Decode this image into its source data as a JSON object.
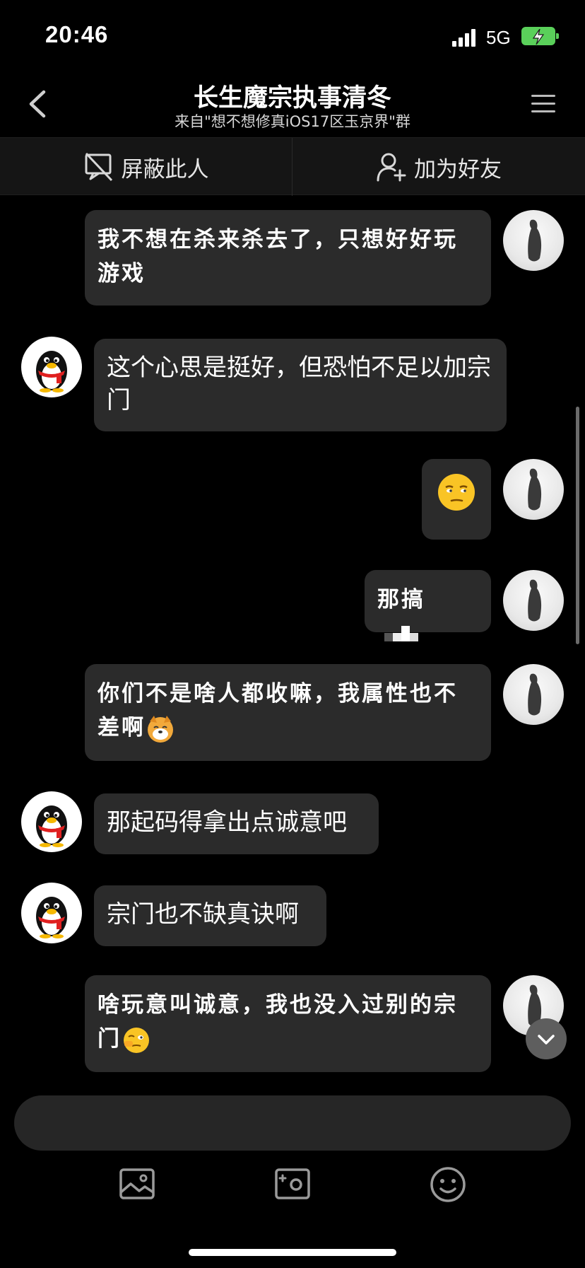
{
  "status_bar": {
    "time": "20:46",
    "network": "5G",
    "battery_color": "#5ad05a"
  },
  "header": {
    "title": "长生魔宗执事清冬",
    "subtitle": "来自\"想不想修真iOS17区玉京界\"群",
    "back_icon": "chevron-left-icon",
    "menu_icon": "menu-icon"
  },
  "actions": {
    "block_label": "屏蔽此人",
    "add_friend_label": "加为好友"
  },
  "messages": [
    {
      "sender": "self",
      "text": "我不想在杀来杀去了，只想好好玩游戏"
    },
    {
      "sender": "other",
      "text": "这个心思是挺好，但恐怕不足以加宗门"
    },
    {
      "sender": "self",
      "text": "",
      "emoji": "smug-face"
    },
    {
      "sender": "self",
      "text": "那搞"
    },
    {
      "sender": "self",
      "text": "你们不是啥人都收嘛，我属性也不差啊",
      "emoji": "dog-face"
    },
    {
      "sender": "other",
      "text": "那起码得拿出点诚意吧"
    },
    {
      "sender": "other",
      "text": "宗门也不缺真诀啊"
    },
    {
      "sender": "self",
      "text": "啥玩意叫诚意，我也没入过别的宗门",
      "emoji": "thinking-face"
    }
  ],
  "input": {
    "placeholder": "",
    "value": ""
  },
  "toolbar": [
    "image-icon",
    "camera-icon",
    "emoji-icon"
  ]
}
